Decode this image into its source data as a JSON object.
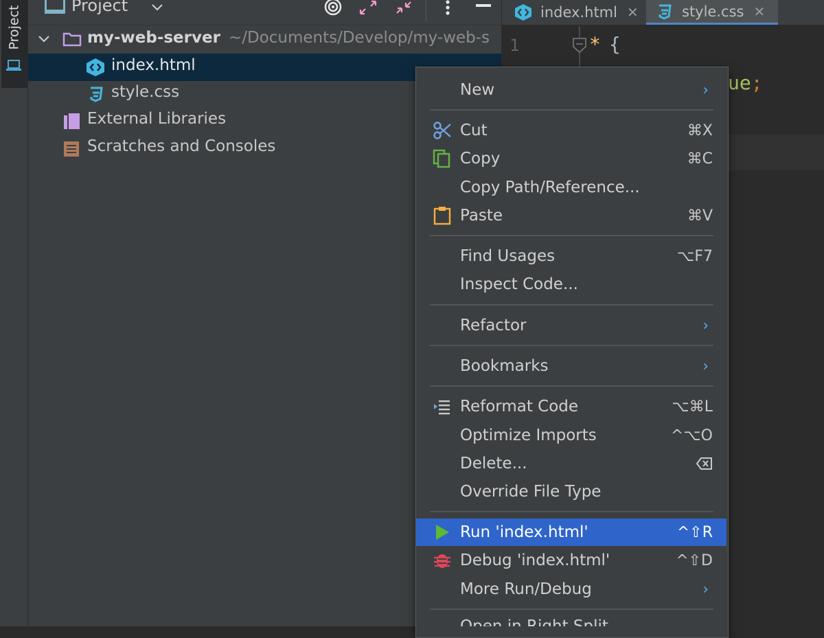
{
  "sidebar": {
    "tab_label": "Project"
  },
  "panel": {
    "title": "Project",
    "tree": {
      "root_name": "my-web-server",
      "root_path": "~/Documents/Develop/my-web-s",
      "files": [
        "index.html",
        "style.css"
      ],
      "external_libraries": "External Libraries",
      "scratches": "Scratches and Consoles"
    }
  },
  "editor": {
    "tabs": [
      "index.html",
      "style.css"
    ],
    "active_tab": "style.css",
    "line_number": "1",
    "code_line1": "*",
    "code_brace": "{",
    "code_line2": "ue",
    "code_semi": ";"
  },
  "context_menu": {
    "new": "New",
    "cut": "Cut",
    "cut_sc": "⌘X",
    "copy": "Copy",
    "copy_sc": "⌘C",
    "copy_path": "Copy Path/Reference...",
    "paste": "Paste",
    "paste_sc": "⌘V",
    "find_usages": "Find Usages",
    "find_usages_sc": "⌥F7",
    "inspect_code": "Inspect Code...",
    "refactor": "Refactor",
    "bookmarks": "Bookmarks",
    "reformat": "Reformat Code",
    "reformat_sc": "⌥⌘L",
    "optimize": "Optimize Imports",
    "optimize_sc": "^⌥O",
    "delete": "Delete...",
    "override": "Override File Type",
    "run": "Run 'index.html'",
    "run_sc": "^⇧R",
    "debug": "Debug 'index.html'",
    "debug_sc": "^⇧D",
    "more_run": "More Run/Debug",
    "open_split": "Open in Right Split"
  },
  "colors": {
    "highlight": "#2f65ca",
    "selection": "#0d293e",
    "accent_arrow": "#5aa9e6",
    "html_icon": "#41b7e0",
    "run_icon": "#5fb832",
    "debug_icon": "#e0455a"
  }
}
